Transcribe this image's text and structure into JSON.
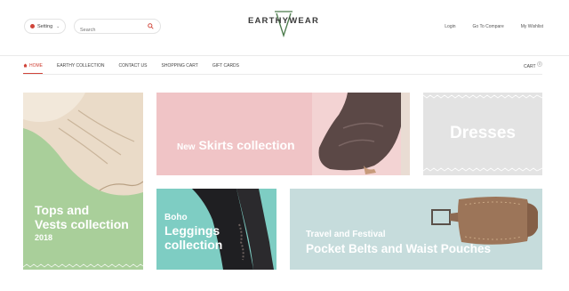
{
  "header": {
    "setting_label": "Setting",
    "search_placeholder": "Search",
    "logo_text": "EARTHYWEAR",
    "links": [
      "Login",
      "Go To Compare",
      "My Wishlist"
    ]
  },
  "nav": {
    "items": [
      "HOME",
      "EARTHY COLLECTION",
      "CONTACT US",
      "SHOPPING CART",
      "GIFT CARDS"
    ],
    "cart_label": "CART",
    "cart_count": "0"
  },
  "banners": {
    "tops": {
      "line1": "Tops and",
      "line2": "Vests collection",
      "line3": "2018"
    },
    "skirts": {
      "small": "New",
      "big": "Skirts collection"
    },
    "dresses": {
      "big": "Dresses"
    },
    "leggings": {
      "small": "Boho",
      "line1": "Leggings",
      "line2": "collection"
    },
    "belts": {
      "small": "Travel and Festival",
      "big": "Pocket Belts and Waist Pouches"
    }
  },
  "colors": {
    "accent": "#d0453a",
    "logo_green": "#4a7a4a",
    "tops_bg": "#a9cf9a",
    "skirts_bg": "#f0c4c6",
    "dresses_bg": "#e3e3e3",
    "leggings_bg": "#7ecdc3",
    "belts_bg": "#c6dcdc"
  },
  "icons": [
    "gear-icon",
    "search-icon",
    "logo-triangle-icon",
    "home-icon",
    "chevron-down-icon"
  ]
}
